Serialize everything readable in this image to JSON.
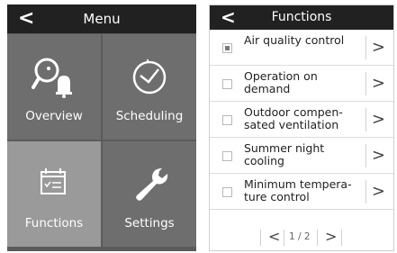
{
  "menu": {
    "back_glyph": "<",
    "title": "Menu",
    "tiles": [
      {
        "label": "Overview",
        "icon": "search-alarm-icon"
      },
      {
        "label": "Scheduling",
        "icon": "clock-icon"
      },
      {
        "label": "Functions",
        "icon": "calendar-list-icon"
      },
      {
        "label": "Settings",
        "icon": "wrench-icon"
      }
    ]
  },
  "functions": {
    "back_glyph": "<",
    "title": "Functions",
    "items": [
      {
        "label": "Air quality control",
        "checked": true
      },
      {
        "label": "Operation on demand",
        "checked": false
      },
      {
        "label": "Outdoor compen-sated ventilation",
        "checked": false
      },
      {
        "label": "Summer night cooling",
        "checked": false
      },
      {
        "label": "Minimum tempera-ture control",
        "checked": false
      }
    ],
    "pager": {
      "prev": "<",
      "page_text": "1 / 2",
      "next": ">"
    }
  },
  "colors": {
    "header": "#212121",
    "tile": "#6e6e6e",
    "tile_active": "#9a9a9a",
    "panel_bg": "#5b5b5b"
  }
}
